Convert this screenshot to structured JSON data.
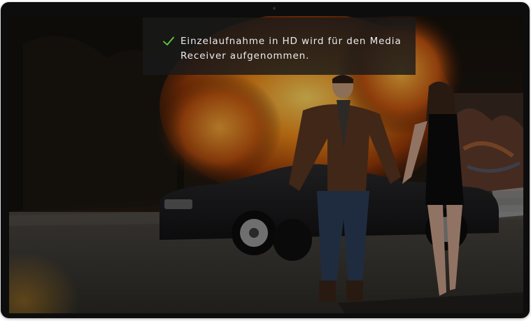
{
  "screen": {
    "background": "movie-scene-explosion-couple-car"
  },
  "notification": {
    "icon": "checkmark-icon",
    "icon_color": "#5fcf3a",
    "message": "Einzelaufnahme in HD wird für den Media Receiver aufgenommen."
  }
}
